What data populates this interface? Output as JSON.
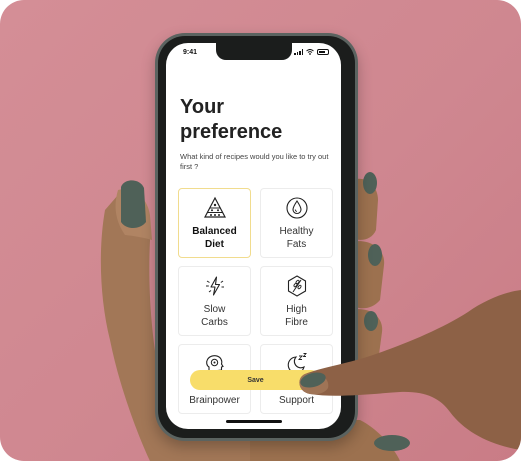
{
  "status_bar": {
    "time": "9:41"
  },
  "screen": {
    "title": "Your preference",
    "subtitle": "What kind of recipes would you  like to try out first ?"
  },
  "options": [
    {
      "label": "Balanced\nDiet",
      "icon": "food-pyramid-icon",
      "selected": true
    },
    {
      "label": "Healthy\nFats",
      "icon": "oil-drop-icon",
      "selected": false
    },
    {
      "label": "Slow\nCarbs",
      "icon": "lightning-icon",
      "selected": false
    },
    {
      "label": "High\nFibre",
      "icon": "wheat-icon",
      "selected": false
    },
    {
      "label": "Boost\nBrainpower",
      "icon": "brain-icon",
      "selected": false
    },
    {
      "label": "Sleep\nSupport",
      "icon": "sleep-moon-icon",
      "selected": false
    }
  ],
  "save_button": {
    "label": "Save"
  },
  "colors": {
    "background": "#cf8790",
    "accent": "#f8dd6a",
    "selected_border": "#f1dc8e",
    "nail_polish": "#4f6158"
  }
}
